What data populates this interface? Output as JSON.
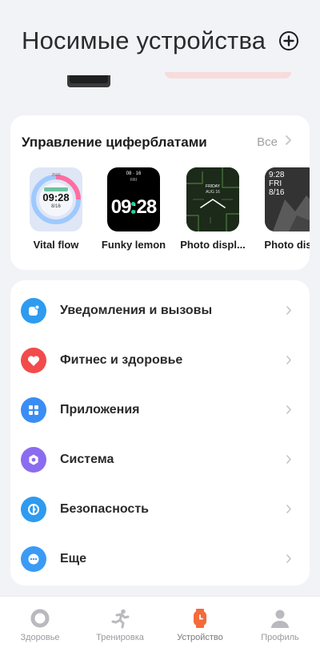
{
  "header": {
    "title": "Носимые устройства"
  },
  "watch_faces": {
    "title": "Управление циферблатами",
    "all_label": "Все",
    "items": [
      {
        "label": "Vital flow",
        "time": "09:28",
        "date": "8/16",
        "steps": "2500"
      },
      {
        "label": "Funky lemon",
        "time": "09:28",
        "date": "08 · 16",
        "day": "FRI"
      },
      {
        "label": "Photo displ...",
        "date": "FRIDAY",
        "day": "AUG 16"
      },
      {
        "label": "Photo disp",
        "time": "9:28",
        "day": "FRI",
        "date": "8/16"
      }
    ]
  },
  "settings": {
    "items": [
      {
        "label": "Уведомления и вызовы",
        "icon": "notification-icon",
        "color": "#2e9bf0"
      },
      {
        "label": "Фитнес и здоровье",
        "icon": "heart-icon",
        "color": "#f24b4b"
      },
      {
        "label": "Приложения",
        "icon": "apps-grid-icon",
        "color": "#3a8df5"
      },
      {
        "label": "Система",
        "icon": "system-hexagon-icon",
        "color": "#8b6cf0"
      },
      {
        "label": "Безопасность",
        "icon": "shield-icon",
        "color": "#2e9bf0"
      },
      {
        "label": "Еще",
        "icon": "more-dots-icon",
        "color": "#3a9bf5"
      }
    ]
  },
  "bottom_nav": {
    "items": [
      {
        "label": "Здоровье",
        "icon": "health-ring-icon"
      },
      {
        "label": "Тренировка",
        "icon": "running-icon"
      },
      {
        "label": "Устройство",
        "icon": "watch-icon",
        "active": true
      },
      {
        "label": "Профиль",
        "icon": "profile-icon"
      }
    ],
    "active_color": "#f46b3a"
  }
}
